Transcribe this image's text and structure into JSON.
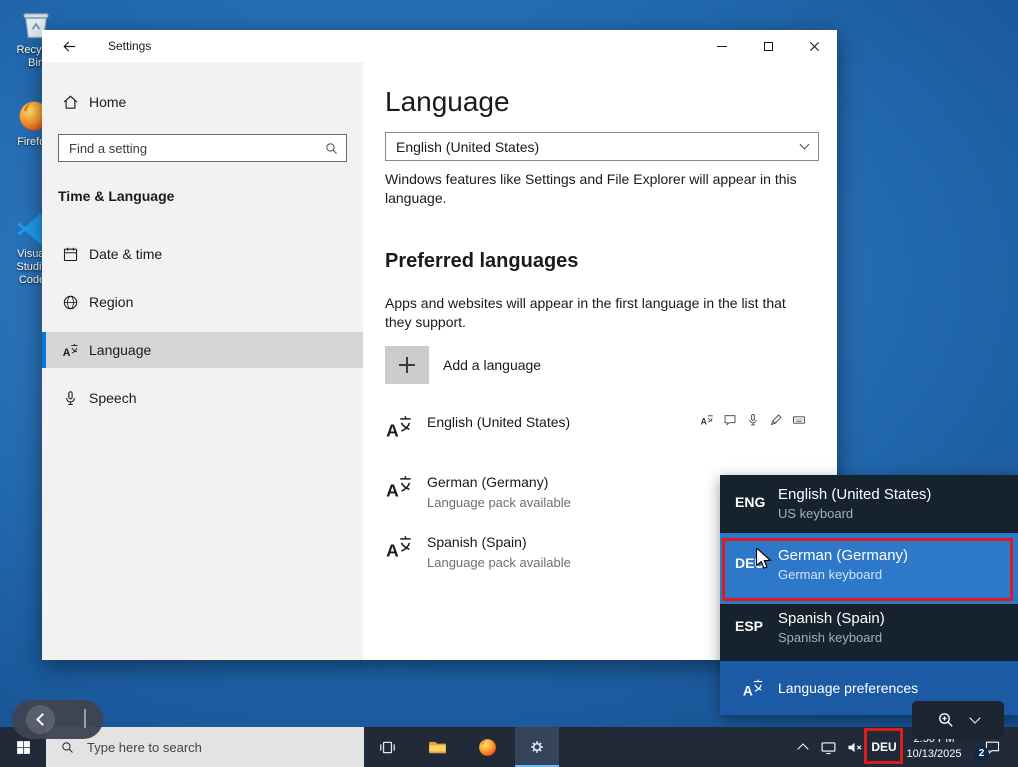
{
  "desktop": {
    "icons": [
      {
        "label": "Recycle Bin"
      },
      {
        "label": "Firefox"
      },
      {
        "label": "Visual Studio Code"
      }
    ]
  },
  "window": {
    "title": "Settings",
    "sidebar": {
      "home": "Home",
      "search_placeholder": "Find a setting",
      "section": "Time & Language",
      "items": [
        {
          "label": "Date & time"
        },
        {
          "label": "Region"
        },
        {
          "label": "Language"
        },
        {
          "label": "Speech"
        }
      ]
    },
    "main": {
      "title": "Language",
      "display_language_value": "English (United States)",
      "display_language_desc": "Windows features like Settings and File Explorer will appear in this language.",
      "preferred_title": "Preferred languages",
      "preferred_desc": "Apps and websites will appear in the first language in the list that they support.",
      "add_label": "Add a language",
      "languages": [
        {
          "name": "English (United States)",
          "note": ""
        },
        {
          "name": "German (Germany)",
          "note": "Language pack available"
        },
        {
          "name": "Spanish (Spain)",
          "note": "Language pack available"
        }
      ]
    }
  },
  "flyout": {
    "items": [
      {
        "code": "ENG",
        "name": "English (United States)",
        "keyboard": "US keyboard"
      },
      {
        "code": "DEU",
        "name": "German (Germany)",
        "keyboard": "German keyboard"
      },
      {
        "code": "ESP",
        "name": "Spanish (Spain)",
        "keyboard": "Spanish keyboard"
      }
    ],
    "preferences": "Language preferences"
  },
  "taskbar": {
    "search_placeholder": "Type here to search",
    "language_code": "DEU",
    "time": "2:50 PM",
    "date": "10/13/2025",
    "notification_count": "2"
  },
  "colors": {
    "accent": "#0078d7",
    "flyout_selected": "#2d78c8",
    "highlight_red": "#d81e1e"
  }
}
